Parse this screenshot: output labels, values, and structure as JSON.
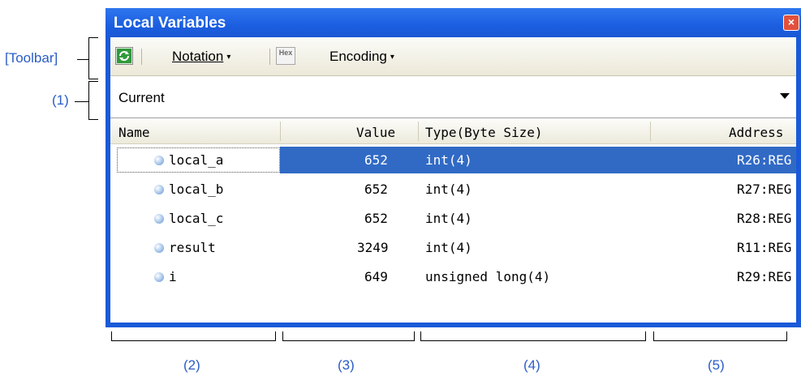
{
  "annotations": {
    "toolbar": "[Toolbar]",
    "one": "(1)",
    "two": "(2)",
    "three": "(3)",
    "four": "(4)",
    "five": "(5)"
  },
  "window": {
    "title": "Local Variables",
    "close_glyph": "×"
  },
  "toolbar": {
    "refresh_icon": "refresh-icon",
    "notation_label": "Notation",
    "notation_arrow": "▾",
    "hex_label": "Hex",
    "encoding_label": "Encoding",
    "encoding_arrow": "▾"
  },
  "scope": {
    "selected": "Current"
  },
  "table": {
    "headers": {
      "name": "Name",
      "value": "Value",
      "type": "Type(Byte Size)",
      "address": "Address"
    },
    "rows": [
      {
        "name": "local_a",
        "value": "652",
        "type": "int(4)",
        "address": "R26:REG",
        "selected": true
      },
      {
        "name": "local_b",
        "value": "652",
        "type": "int(4)",
        "address": "R27:REG",
        "selected": false
      },
      {
        "name": "local_c",
        "value": "652",
        "type": "int(4)",
        "address": "R28:REG",
        "selected": false
      },
      {
        "name": "result",
        "value": "3249",
        "type": "int(4)",
        "address": "R11:REG",
        "selected": false
      },
      {
        "name": "i",
        "value": "649",
        "type": "unsigned long(4)",
        "address": "R29:REG",
        "selected": false
      }
    ]
  },
  "colors": {
    "titlebar": "#1b5ee0",
    "selection": "#316ac5",
    "annotation": "#2a5cc8"
  }
}
